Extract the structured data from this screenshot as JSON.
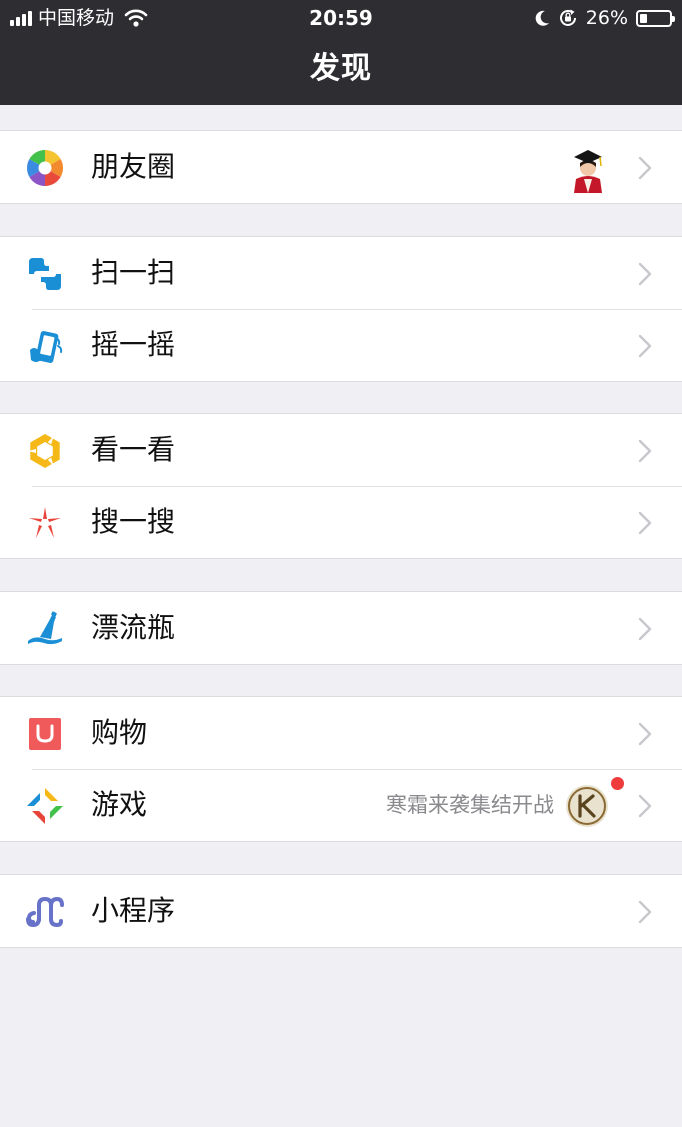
{
  "status_bar": {
    "carrier": "中国移动",
    "time": "20:59",
    "battery_percent_text": "26%",
    "battery_level": 0.26,
    "icons": [
      "signal-icon",
      "wifi-icon",
      "moon-icon",
      "orientation-lock-icon",
      "battery-icon"
    ]
  },
  "nav": {
    "title": "发现"
  },
  "groups": [
    {
      "items": [
        {
          "label": "朋友圈",
          "icon": "moments-icon"
        }
      ]
    },
    {
      "items": [
        {
          "label": "扫一扫",
          "icon": "scan-icon"
        },
        {
          "label": "摇一摇",
          "icon": "shake-icon"
        }
      ]
    },
    {
      "items": [
        {
          "label": "看一看",
          "icon": "top-stories-icon"
        },
        {
          "label": "搜一搜",
          "icon": "search-icon"
        }
      ]
    },
    {
      "items": [
        {
          "label": "漂流瓶",
          "icon": "drift-bottle-icon"
        }
      ]
    },
    {
      "items": [
        {
          "label": "购物",
          "icon": "shopping-icon"
        },
        {
          "label": "游戏",
          "icon": "games-icon",
          "subtitle": "寒霜来袭集结开战",
          "has_badge_dot": true
        }
      ]
    },
    {
      "items": [
        {
          "label": "小程序",
          "icon": "mini-programs-icon"
        }
      ]
    }
  ],
  "colors": {
    "nav_background": "#2d2d32",
    "page_background": "#efeff4",
    "badge_red": "#ef3b3b",
    "chevron": "#c7c7cc"
  }
}
